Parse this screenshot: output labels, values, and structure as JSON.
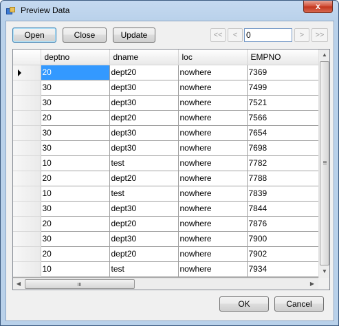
{
  "window": {
    "title": "Preview Data",
    "close_glyph": "x"
  },
  "toolbar": {
    "open_label": "Open",
    "close_label": "Close",
    "update_label": "Update",
    "first_glyph": "<<",
    "prev_glyph": "<",
    "page_value": "0",
    "next_glyph": ">",
    "last_glyph": ">>"
  },
  "grid": {
    "columns": [
      "deptno",
      "dname",
      "loc",
      "EMPNO"
    ],
    "rows": [
      [
        "20",
        "dept20",
        "nowhere",
        "7369"
      ],
      [
        "30",
        "dept30",
        "nowhere",
        "7499"
      ],
      [
        "30",
        "dept30",
        "nowhere",
        "7521"
      ],
      [
        "20",
        "dept20",
        "nowhere",
        "7566"
      ],
      [
        "30",
        "dept30",
        "nowhere",
        "7654"
      ],
      [
        "30",
        "dept30",
        "nowhere",
        "7698"
      ],
      [
        "10",
        "test",
        "nowhere",
        "7782"
      ],
      [
        "20",
        "dept20",
        "nowhere",
        "7788"
      ],
      [
        "10",
        "test",
        "nowhere",
        "7839"
      ],
      [
        "30",
        "dept30",
        "nowhere",
        "7844"
      ],
      [
        "20",
        "dept20",
        "nowhere",
        "7876"
      ],
      [
        "30",
        "dept30",
        "nowhere",
        "7900"
      ],
      [
        "20",
        "dept20",
        "nowhere",
        "7902"
      ],
      [
        "10",
        "test",
        "nowhere",
        "7934"
      ]
    ],
    "selected_row": 0,
    "selected_col": 0,
    "hscroll_glyph": "III",
    "vscroll_glyph": "≡"
  },
  "footer": {
    "ok_label": "OK",
    "cancel_label": "Cancel"
  },
  "colors": {
    "selection": "#3399ff",
    "title_bar": "#b9d1ea",
    "close_button": "#c2341c"
  },
  "icons": [
    "app-icon",
    "close-icon",
    "row-indicator-icon",
    "scroll-up-icon",
    "scroll-down-icon",
    "scroll-left-icon",
    "scroll-right-icon"
  ]
}
